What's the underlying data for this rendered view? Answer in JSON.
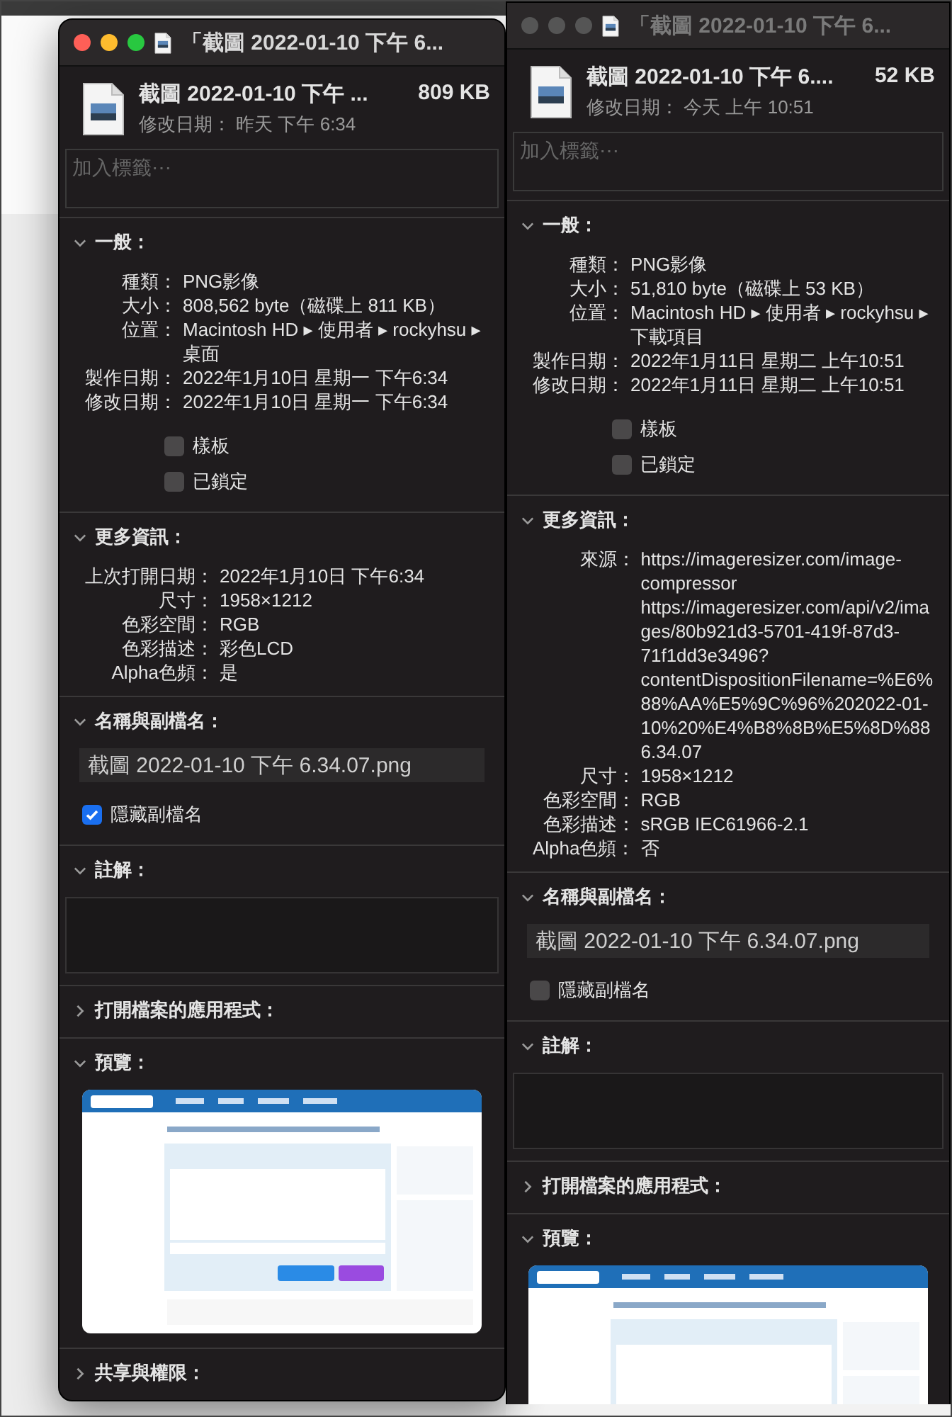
{
  "windows": [
    {
      "active": true,
      "title": "「截圖 2022-01-10 下午 6...",
      "name": "截圖 2022-01-10 下午 ...",
      "size": "809 KB",
      "modified": "修改日期： 昨天 下午 6:34",
      "tags_placeholder": "加入標籤⋯",
      "sections": [
        {
          "kind": "info",
          "title": "一般：",
          "expanded": true,
          "rows": [
            {
              "label": "種類：",
              "values": [
                "PNG影像"
              ]
            },
            {
              "label": "大小：",
              "values": [
                "808,562 byte（磁碟上 811 KB）"
              ]
            },
            {
              "label": "位置：",
              "values": [
                "Macintosh HD ▸ 使用者 ▸ rockyhsu ▸ 桌面"
              ]
            },
            {
              "label": "製作日期：",
              "values": [
                "2022年1月10日 星期一 下午6:34"
              ]
            },
            {
              "label": "修改日期：",
              "values": [
                "2022年1月10日 星期一 下午6:34"
              ]
            }
          ],
          "checkboxes": [
            {
              "label": "樣板",
              "checked": false
            },
            {
              "label": "已鎖定",
              "checked": false
            }
          ]
        },
        {
          "kind": "info",
          "title": "更多資訊：",
          "expanded": true,
          "rows": [
            {
              "label": "上次打開日期：",
              "values": [
                "2022年1月10日 下午6:34"
              ]
            },
            {
              "label": "尺寸：",
              "values": [
                "1958×1212"
              ]
            },
            {
              "label": "色彩空間：",
              "values": [
                "RGB"
              ]
            },
            {
              "label": "色彩描述：",
              "values": [
                "彩色LCD"
              ]
            },
            {
              "label": "Alpha色頻：",
              "values": [
                "是"
              ]
            }
          ]
        },
        {
          "kind": "name",
          "title": "名稱與副檔名：",
          "expanded": true,
          "value": "截圖 2022-01-10 下午 6.34.07.png",
          "checkboxes": [
            {
              "label": "隱藏副檔名",
              "checked": true
            }
          ]
        },
        {
          "kind": "comments",
          "title": "註解：",
          "expanded": true
        },
        {
          "title": "打開檔案的應用程式：",
          "expanded": false
        },
        {
          "kind": "preview",
          "title": "預覽：",
          "expanded": true
        },
        {
          "title": "共享與權限：",
          "expanded": false
        }
      ]
    },
    {
      "active": false,
      "title": "「截圖 2022-01-10 下午 6...",
      "name": "截圖 2022-01-10 下午 6....",
      "size": "52 KB",
      "modified": "修改日期： 今天 上午 10:51",
      "tags_placeholder": "加入標籤⋯",
      "sections": [
        {
          "kind": "info",
          "title": "一般：",
          "expanded": true,
          "rows": [
            {
              "label": "種類：",
              "values": [
                "PNG影像"
              ]
            },
            {
              "label": "大小：",
              "values": [
                "51,810 byte（磁碟上 53 KB）"
              ]
            },
            {
              "label": "位置：",
              "values": [
                "Macintosh HD ▸ 使用者 ▸ rockyhsu ▸ 下載項目"
              ]
            },
            {
              "label": "製作日期：",
              "values": [
                "2022年1月11日 星期二 上午10:51"
              ]
            },
            {
              "label": "修改日期：",
              "values": [
                "2022年1月11日 星期二 上午10:51"
              ]
            }
          ],
          "checkboxes": [
            {
              "label": "樣板",
              "checked": false
            },
            {
              "label": "已鎖定",
              "checked": false
            }
          ]
        },
        {
          "kind": "info",
          "title": "更多資訊：",
          "expanded": true,
          "rows": [
            {
              "label": "來源：",
              "values": [
                "https://imageresizer.com/image-compressor",
                "https://imageresizer.com/api/v2/images/80b921d3-5701-419f-87d3-71f1dd3e3496?contentDispositionFilename=%E6%88%AA%E5%9C%96%202022-01-10%20%E4%B8%8B%E5%8D%886.34.07"
              ]
            },
            {
              "label": "尺寸：",
              "values": [
                "1958×1212"
              ]
            },
            {
              "label": "色彩空間：",
              "values": [
                "RGB"
              ]
            },
            {
              "label": "色彩描述：",
              "values": [
                "sRGB IEC61966-2.1"
              ]
            },
            {
              "label": "Alpha色頻：",
              "values": [
                "否"
              ]
            }
          ]
        },
        {
          "kind": "name",
          "title": "名稱與副檔名：",
          "expanded": true,
          "value": "截圖 2022-01-10 下午 6.34.07.png",
          "checkboxes": [
            {
              "label": "隱藏副檔名",
              "checked": false
            }
          ]
        },
        {
          "kind": "comments",
          "title": "註解：",
          "expanded": true
        },
        {
          "title": "打開檔案的應用程式：",
          "expanded": false
        },
        {
          "kind": "preview",
          "title": "預覽：",
          "expanded": true
        }
      ]
    }
  ]
}
